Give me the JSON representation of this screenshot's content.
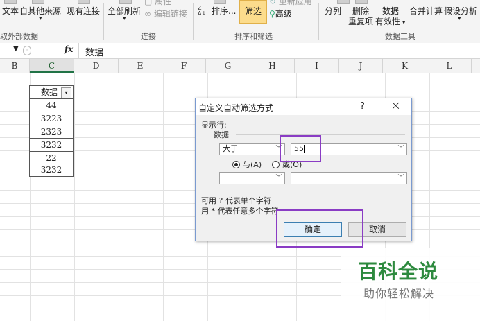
{
  "ribbon": {
    "buttons": {
      "from_text": "文本",
      "other_sources": "自其他来源",
      "existing_conn": "现有连接",
      "refresh_all": "全部刷新",
      "properties": "属性",
      "edit_links": "编辑链接",
      "sort_icon": "Z↓A",
      "sort": "排序...",
      "filter": "筛选",
      "reapply": "重新应用",
      "advanced": "高级",
      "text_to_columns": "分列",
      "remove_dup_1": "删除",
      "remove_dup_2": "重复项",
      "validation_1": "数据",
      "validation_2": "有效性",
      "consolidate": "合并计算",
      "what_if": "假设分析"
    },
    "groups": {
      "external": "取外部数据",
      "connections": "连接",
      "sort_filter": "排序和筛选",
      "data_tools": "数据工具"
    }
  },
  "formula_bar": {
    "fx": "fx",
    "content": "数据"
  },
  "columns": [
    "B",
    "C",
    "D",
    "E",
    "F",
    "G",
    "H",
    "I",
    "J",
    "K",
    "L"
  ],
  "cells": {
    "header": "数据",
    "values": [
      "44",
      "3223",
      "2323",
      "3232",
      "22",
      "3232"
    ]
  },
  "dialog": {
    "title": "自定义自动筛选方式",
    "help": "?",
    "close": "×",
    "show_rows": "显示行:",
    "field": "数据",
    "operator1": "大于",
    "value1": "55",
    "and_label": "与(A)",
    "or_label": "或(O)",
    "operator2": "",
    "value2": "",
    "hint1": "可用 ? 代表单个字符",
    "hint2": "用 * 代表任意多个字符",
    "ok": "确定",
    "cancel": "取消",
    "colors": {
      "highlight": "#8a3cc4"
    }
  },
  "watermark": {
    "title": "百科全说",
    "subtitle": "助你轻松解决"
  }
}
